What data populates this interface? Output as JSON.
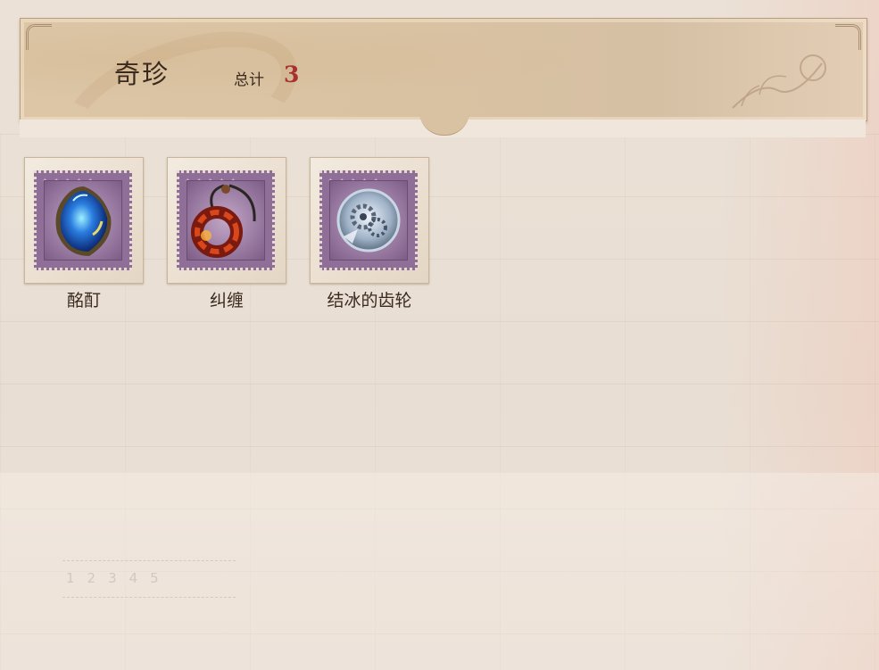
{
  "header": {
    "title": "奇珍",
    "total_label": "总计",
    "total_count": "3"
  },
  "items": [
    {
      "name": "酩酊",
      "icon": "blue-heart-crystal-icon"
    },
    {
      "name": "纠缠",
      "icon": "red-ring-pendant-icon"
    },
    {
      "name": "结冰的齿轮",
      "icon": "frozen-gear-icon"
    }
  ],
  "colors": {
    "count": "#a83030",
    "stamp": "#8f6f97",
    "banner": "#dcc6a6"
  }
}
